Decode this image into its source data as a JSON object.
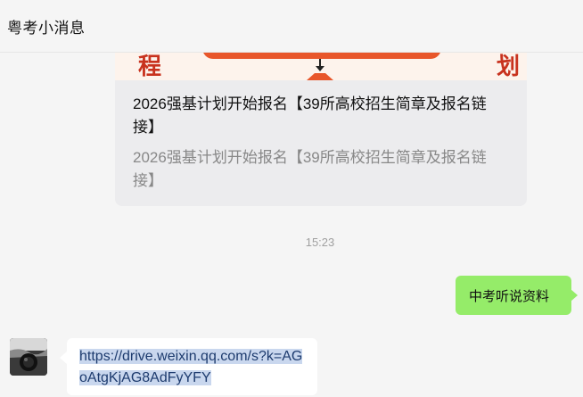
{
  "header": {
    "title": "粤考小消息"
  },
  "article": {
    "banner_left_char": "程",
    "banner_right_char": "划",
    "title": "2026强基计划开始报名【39所高校招生简章及报名链接】",
    "description": "2026强基计划开始报名【39所高校招生简章及报名链接】"
  },
  "timestamp": "15:23",
  "messages": {
    "outgoing_text": "中考听说资料",
    "incoming_link": "https://drive.weixin.qq.com/s?k=AGoAtgKjAG8AdFyYFY"
  },
  "colors": {
    "outgoing_bubble": "#95ec69",
    "incoming_bubble": "#ffffff",
    "banner_accent": "#e8562a",
    "link_highlight": "#c9d7ee"
  },
  "icons": {
    "avatar": "avatar-image"
  }
}
